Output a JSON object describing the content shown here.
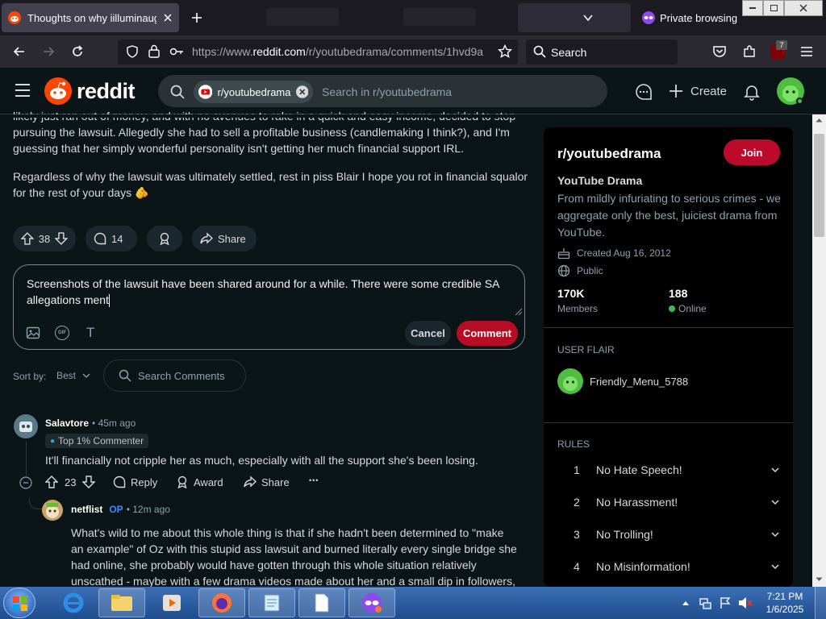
{
  "browser": {
    "tab_title": "Thoughts on why iilluminaughti",
    "url_prefix": "https://www.",
    "url_domain": "reddit.com",
    "url_path": "/r/youtubedrama/comments/1hvd9a",
    "search_placeholder": "Search",
    "private_label": "Private browsing",
    "extension_badge": "7"
  },
  "reddit_header": {
    "logo_text": "reddit",
    "search_chip": "r/youtubedrama",
    "search_placeholder": "Search in r/youtubedrama",
    "create_label": "Create"
  },
  "post": {
    "para1_line1": "likely just ran out of money, and with no avenues to rake in a quick and easy income, decided to stop",
    "para1_line2": "pursuing the lawsuit. Allegedly she had to sell a profitable business (candlemaking I think?), and I'm",
    "para1_line3": "guessing that her simply wonderful personality isn't getting her much financial support IRL.",
    "para2_line1": "Regardless of why the lawsuit was ultimately settled, rest in piss Blair I hope you rot in financial squalor",
    "para2_line2": "for the rest of your days 🫵",
    "votes": "38",
    "comments": "14",
    "share_label": "Share"
  },
  "editor": {
    "text_line1": "Screenshots of the lawsuit have been shared around for a while. There were some credible SA",
    "text_line2": "allegations ment",
    "gif_label": "GIF",
    "text_tool": "T",
    "cancel_label": "Cancel",
    "comment_label": "Comment"
  },
  "sort": {
    "label": "Sort by:",
    "value": "Best",
    "search_placeholder": "Search Comments"
  },
  "comments": [
    {
      "author": "Salavtore",
      "time": "• 45m ago",
      "flair": "Top 1% Commenter",
      "text": "It'll financially not cripple her as much, especially with all the support she's been losing.",
      "votes": "23",
      "reply_label": "Reply",
      "award_label": "Award",
      "share_label": "Share",
      "more": "•••"
    },
    {
      "author": "netflist",
      "op_badge": "OP",
      "time": "• 12m ago",
      "line1": "What's wild to me about this whole thing is that if she hadn't been determined to \"make",
      "line2": "an example\" of Oz with this stupid ass lawsuit and burned literally every single bridge she",
      "line3": "had online, she probably would have gotten through this whole situation relatively",
      "line4": "unscathed - maybe with a few drama videos made about her and a small dip in followers,"
    }
  ],
  "sidebar": {
    "sub_name": "r/youtubedrama",
    "join_label": "Join",
    "title": "YouTube Drama",
    "desc_line1": "From mildly infuriating to serious crimes - we",
    "desc_line2": "aggregate only the best, juiciest drama from",
    "desc_line3": "YouTube.",
    "created": "Created Aug 16, 2012",
    "visibility": "Public",
    "members_count": "170K",
    "members_label": "Members",
    "online_count": "188",
    "online_label": "Online",
    "user_flair_heading": "USER FLAIR",
    "username": "Friendly_Menu_5788",
    "rules_heading": "RULES",
    "rules": [
      {
        "num": "1",
        "text": "No Hate Speech!"
      },
      {
        "num": "2",
        "text": "No Harassment!"
      },
      {
        "num": "3",
        "text": "No Trolling!"
      },
      {
        "num": "4",
        "text": "No Misinformation!"
      }
    ]
  },
  "taskbar": {
    "time": "7:21 PM",
    "date": "1/6/2025"
  },
  "colors": {
    "reddit_orange": "#ff4500",
    "join_red": "#bc0a2b",
    "comment_red": "#b60d26",
    "online_green": "#3fb950",
    "avatar_green": "#4fbd3f"
  }
}
